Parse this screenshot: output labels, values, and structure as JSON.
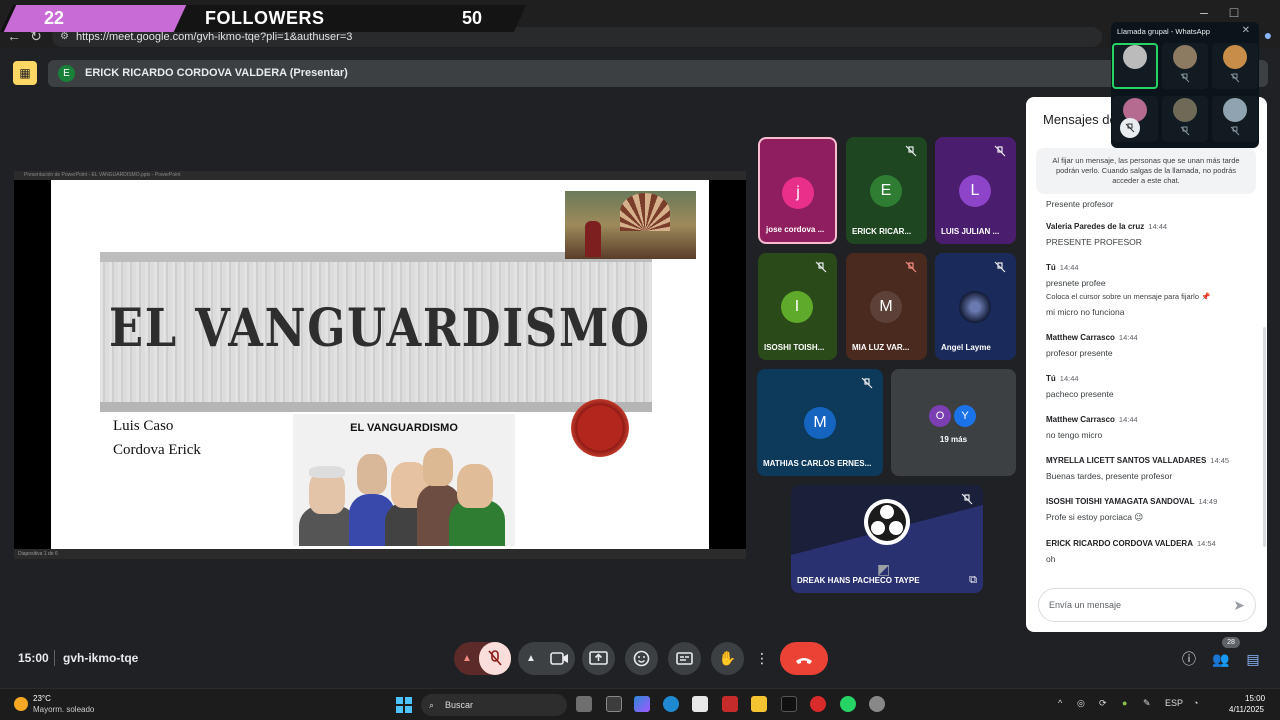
{
  "overlay": {
    "left_number": "22",
    "label": "FOLLOWERS",
    "right_number": "50"
  },
  "browser": {
    "url": "https://meet.google.com/gvh-ikmo-tqe?pli=1&authuser=3"
  },
  "presenter": {
    "initial": "E",
    "name": "ERICK RICARDO CORDOVA VALDERA (Presentar)"
  },
  "slide_window": {
    "titlebar": "Presentación de PowerPoint - EL VANGUARDISMO.pptx - PowerPoint",
    "status": "Diapositiva 1 de 6"
  },
  "slide": {
    "title": "EL VANGUARDISMO",
    "authors": [
      "Luis Caso",
      "Cordova Erick"
    ],
    "image_caption": "EL VANGUARDISMO"
  },
  "tiles": [
    {
      "initial": "j",
      "name": "jose cordova ...",
      "bg": "#8e1e5e",
      "av": "#e8308a"
    },
    {
      "initial": "E",
      "name": "ERICK RICAR...",
      "bg": "#1e4620",
      "av": "#2e7d32"
    },
    {
      "initial": "L",
      "name": "LUIS JULIAN ...",
      "bg": "#4a1d6e",
      "av": "#8e44c9"
    },
    {
      "initial": "I",
      "name": "ISOSHI TOISH...",
      "bg": "#2a4a1a",
      "av": "#5faa2a"
    },
    {
      "initial": "M",
      "name": "MIA LUZ VAR...",
      "bg": "#4a2a1e",
      "av": "#5d4037"
    },
    {
      "initial": "",
      "name": "Angel Layme",
      "bg": "#1a2a5a",
      "av": "#334"
    },
    {
      "initial": "M",
      "name": "MATHIAS CARLOS ERNES...",
      "bg": "#0d3a5a",
      "av": "#1565c0"
    },
    {
      "initial": "",
      "name": "19 más",
      "bg": "#3c4043",
      "av": ""
    },
    {
      "initial": "",
      "name": "DREAK HANS PACHECO TAYPE",
      "bg": "#1a1f3a",
      "av": ""
    }
  ],
  "more_avatars": [
    "O",
    "Y"
  ],
  "chat": {
    "title": "Mensajes de la llamada",
    "note": "Al fijar un mensaje, las personas que se unan más tarde podrán verlo. Cuando salgas de la llamada, no podrás acceder a este chat.",
    "messages": [
      {
        "sender": "",
        "time": "",
        "lines": [
          "Presente profesor"
        ]
      },
      {
        "sender": "Valeria Paredes de la cruz",
        "time": "14:44",
        "lines": [
          "PRESENTE PROFESOR"
        ]
      },
      {
        "sender": "Tú",
        "time": "14:44",
        "lines": [
          "presnete profee",
          "Coloca el cursor sobre un mensaje para fijarlo 📌",
          "mi micro no funciona"
        ]
      },
      {
        "sender": "Matthew Carrasco",
        "time": "14:44",
        "lines": [
          "profesor presente"
        ]
      },
      {
        "sender": "Tú",
        "time": "14:44",
        "lines": [
          "pacheco presente"
        ]
      },
      {
        "sender": "Matthew Carrasco",
        "time": "14:44",
        "lines": [
          "no tengo micro"
        ]
      },
      {
        "sender": "MYRELLA LICETT SANTOS VALLADARES",
        "time": "14:45",
        "lines": [
          "Buenas tardes, presente profesor"
        ]
      },
      {
        "sender": "ISOSHI TOISHI YAMAGATA SANDOVAL",
        "time": "14:49",
        "lines": [
          "Profe si estoy porciaca 😉"
        ]
      },
      {
        "sender": "ERICK RICARDO CORDOVA VALDERA",
        "time": "14:54",
        "lines": [
          "oh"
        ]
      }
    ],
    "input_placeholder": "Envía un mensaje"
  },
  "whatsapp": {
    "title": "Llamada grupal - WhatsApp"
  },
  "bottom": {
    "time": "15:00",
    "code": "gvh-ikmo-tqe",
    "participants": "28"
  },
  "taskbar": {
    "temp": "23°C",
    "weather": "Mayorm. soleado",
    "search": "Buscar",
    "lang": "ESP",
    "clock_time": "15:00",
    "clock_date": "4/11/2025"
  }
}
